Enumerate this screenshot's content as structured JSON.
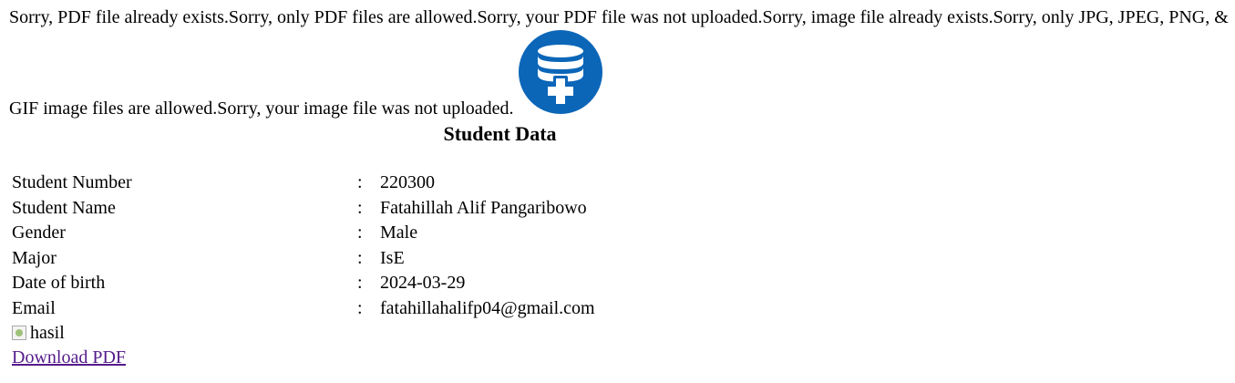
{
  "messages": {
    "line1": "Sorry, PDF file already exists.Sorry, only PDF files are allowed.Sorry, your PDF file was not uploaded.Sorry, image file already exists.Sorry, only JPG, JPEG, PNG, &",
    "line2": "GIF image files are allowed.Sorry, your image file was not uploaded."
  },
  "logo": {
    "icon": "database-add-icon",
    "color": "#0b66b8"
  },
  "page_title": "Student Data",
  "student": {
    "separator": ":",
    "rows": [
      {
        "label": "Student Number",
        "value": "220300"
      },
      {
        "label": "Student Name",
        "value": "Fatahillah Alif Pangaribowo"
      },
      {
        "label": "Gender",
        "value": "Male"
      },
      {
        "label": "Major",
        "value": "IsE"
      },
      {
        "label": "Date of birth",
        "value": "2024-03-29"
      },
      {
        "label": "Email",
        "value": "fatahillahalifp04@gmail.com"
      }
    ]
  },
  "result_image": {
    "alt": "hasil"
  },
  "download_link": {
    "label": "Download PDF",
    "color": "#551a8b"
  }
}
